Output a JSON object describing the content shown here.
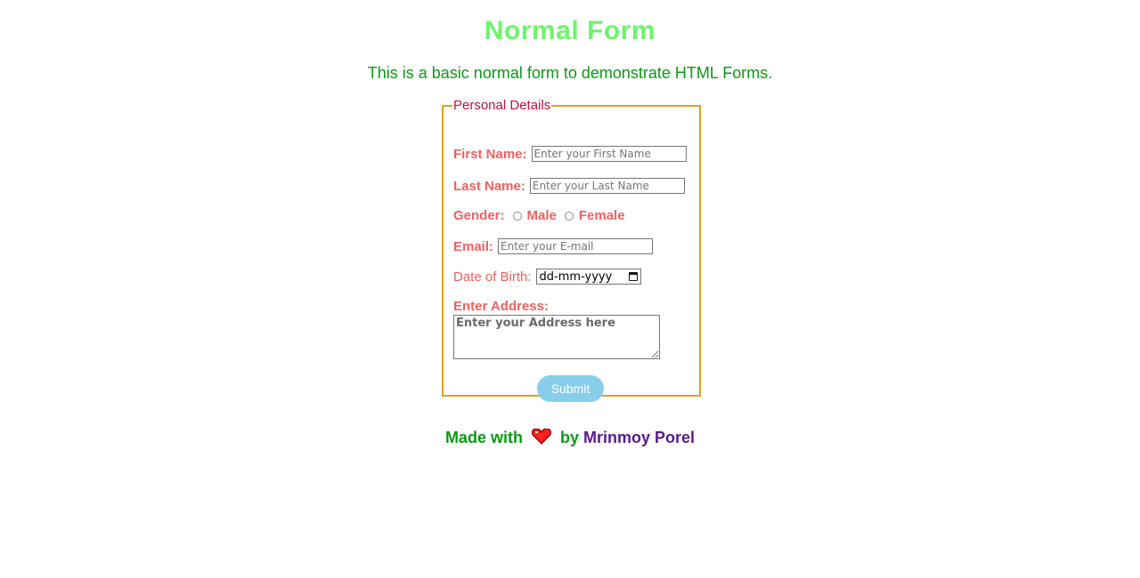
{
  "header": {
    "title": "Normal Form",
    "subtitle": "This is a basic normal form to demonstrate HTML Forms."
  },
  "form": {
    "legend": "Personal Details",
    "first_name": {
      "label": "First Name:",
      "placeholder": "Enter your First Name",
      "value": ""
    },
    "last_name": {
      "label": "Last Name:",
      "placeholder": "Enter your Last Name",
      "value": ""
    },
    "gender": {
      "label": "Gender:",
      "options": [
        "Male",
        "Female"
      ],
      "selected": ""
    },
    "email": {
      "label": "Email:",
      "placeholder": "Enter your E-mail",
      "value": ""
    },
    "dob": {
      "label": "Date of Birth:",
      "display": "dd-mm-yyyy",
      "icon": "calendar-icon"
    },
    "address": {
      "label": "Enter Address:",
      "placeholder": "Enter your Address here",
      "value": ""
    },
    "submit_label": "Submit"
  },
  "footer": {
    "made_with": "Made with",
    "by": "by",
    "author": "Mrinmoy Porel",
    "icon": "heart-icon"
  },
  "colors": {
    "title": "#6cf56c",
    "subtitle": "#0a9a12",
    "label": "#f06060",
    "legend": "#c0103a",
    "fieldset_border": "#e0a21d",
    "submit_bg": "#87ceeb",
    "author": "#5a1a8a"
  }
}
